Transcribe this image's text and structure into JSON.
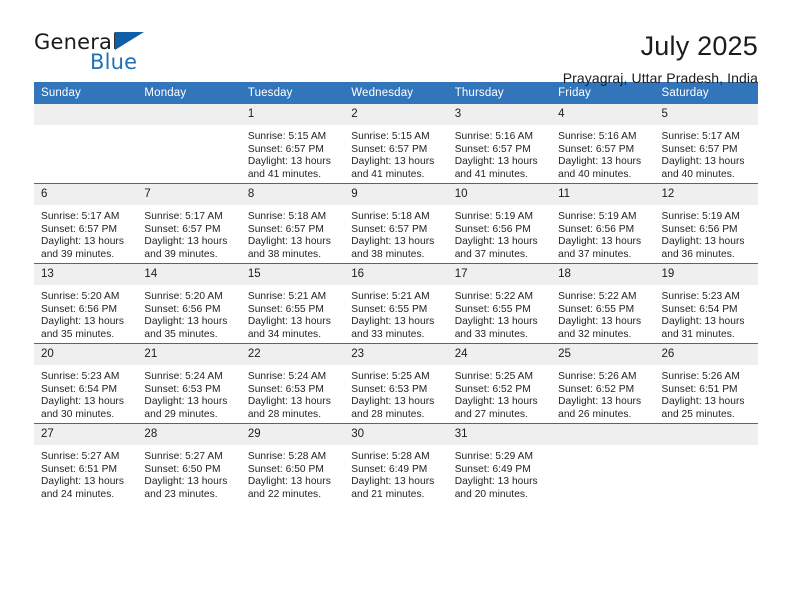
{
  "brand": {
    "name_top": "General",
    "name_bottom": "Blue",
    "triangle_color": "#0f5fa8",
    "blue_text_color": "#2072b8"
  },
  "header": {
    "title": "July 2025",
    "subtitle": "Prayagraj, Uttar Pradesh, India"
  },
  "theme": {
    "header_row_bg": "#3275bb",
    "daynum_bg": "#efefef",
    "row_border": "#2f6daf",
    "page_bg": "#ffffff"
  },
  "weekdays": [
    "Sunday",
    "Monday",
    "Tuesday",
    "Wednesday",
    "Thursday",
    "Friday",
    "Saturday"
  ],
  "weeks": [
    [
      {
        "day": "",
        "sunrise": "",
        "sunset": "",
        "daylight_1": "",
        "daylight_2": ""
      },
      {
        "day": "",
        "sunrise": "",
        "sunset": "",
        "daylight_1": "",
        "daylight_2": ""
      },
      {
        "day": "1",
        "sunrise": "Sunrise: 5:15 AM",
        "sunset": "Sunset: 6:57 PM",
        "daylight_1": "Daylight: 13 hours",
        "daylight_2": "and 41 minutes."
      },
      {
        "day": "2",
        "sunrise": "Sunrise: 5:15 AM",
        "sunset": "Sunset: 6:57 PM",
        "daylight_1": "Daylight: 13 hours",
        "daylight_2": "and 41 minutes."
      },
      {
        "day": "3",
        "sunrise": "Sunrise: 5:16 AM",
        "sunset": "Sunset: 6:57 PM",
        "daylight_1": "Daylight: 13 hours",
        "daylight_2": "and 41 minutes."
      },
      {
        "day": "4",
        "sunrise": "Sunrise: 5:16 AM",
        "sunset": "Sunset: 6:57 PM",
        "daylight_1": "Daylight: 13 hours",
        "daylight_2": "and 40 minutes."
      },
      {
        "day": "5",
        "sunrise": "Sunrise: 5:17 AM",
        "sunset": "Sunset: 6:57 PM",
        "daylight_1": "Daylight: 13 hours",
        "daylight_2": "and 40 minutes."
      }
    ],
    [
      {
        "day": "6",
        "sunrise": "Sunrise: 5:17 AM",
        "sunset": "Sunset: 6:57 PM",
        "daylight_1": "Daylight: 13 hours",
        "daylight_2": "and 39 minutes."
      },
      {
        "day": "7",
        "sunrise": "Sunrise: 5:17 AM",
        "sunset": "Sunset: 6:57 PM",
        "daylight_1": "Daylight: 13 hours",
        "daylight_2": "and 39 minutes."
      },
      {
        "day": "8",
        "sunrise": "Sunrise: 5:18 AM",
        "sunset": "Sunset: 6:57 PM",
        "daylight_1": "Daylight: 13 hours",
        "daylight_2": "and 38 minutes."
      },
      {
        "day": "9",
        "sunrise": "Sunrise: 5:18 AM",
        "sunset": "Sunset: 6:57 PM",
        "daylight_1": "Daylight: 13 hours",
        "daylight_2": "and 38 minutes."
      },
      {
        "day": "10",
        "sunrise": "Sunrise: 5:19 AM",
        "sunset": "Sunset: 6:56 PM",
        "daylight_1": "Daylight: 13 hours",
        "daylight_2": "and 37 minutes."
      },
      {
        "day": "11",
        "sunrise": "Sunrise: 5:19 AM",
        "sunset": "Sunset: 6:56 PM",
        "daylight_1": "Daylight: 13 hours",
        "daylight_2": "and 37 minutes."
      },
      {
        "day": "12",
        "sunrise": "Sunrise: 5:19 AM",
        "sunset": "Sunset: 6:56 PM",
        "daylight_1": "Daylight: 13 hours",
        "daylight_2": "and 36 minutes."
      }
    ],
    [
      {
        "day": "13",
        "sunrise": "Sunrise: 5:20 AM",
        "sunset": "Sunset: 6:56 PM",
        "daylight_1": "Daylight: 13 hours",
        "daylight_2": "and 35 minutes."
      },
      {
        "day": "14",
        "sunrise": "Sunrise: 5:20 AM",
        "sunset": "Sunset: 6:56 PM",
        "daylight_1": "Daylight: 13 hours",
        "daylight_2": "and 35 minutes."
      },
      {
        "day": "15",
        "sunrise": "Sunrise: 5:21 AM",
        "sunset": "Sunset: 6:55 PM",
        "daylight_1": "Daylight: 13 hours",
        "daylight_2": "and 34 minutes."
      },
      {
        "day": "16",
        "sunrise": "Sunrise: 5:21 AM",
        "sunset": "Sunset: 6:55 PM",
        "daylight_1": "Daylight: 13 hours",
        "daylight_2": "and 33 minutes."
      },
      {
        "day": "17",
        "sunrise": "Sunrise: 5:22 AM",
        "sunset": "Sunset: 6:55 PM",
        "daylight_1": "Daylight: 13 hours",
        "daylight_2": "and 33 minutes."
      },
      {
        "day": "18",
        "sunrise": "Sunrise: 5:22 AM",
        "sunset": "Sunset: 6:55 PM",
        "daylight_1": "Daylight: 13 hours",
        "daylight_2": "and 32 minutes."
      },
      {
        "day": "19",
        "sunrise": "Sunrise: 5:23 AM",
        "sunset": "Sunset: 6:54 PM",
        "daylight_1": "Daylight: 13 hours",
        "daylight_2": "and 31 minutes."
      }
    ],
    [
      {
        "day": "20",
        "sunrise": "Sunrise: 5:23 AM",
        "sunset": "Sunset: 6:54 PM",
        "daylight_1": "Daylight: 13 hours",
        "daylight_2": "and 30 minutes."
      },
      {
        "day": "21",
        "sunrise": "Sunrise: 5:24 AM",
        "sunset": "Sunset: 6:53 PM",
        "daylight_1": "Daylight: 13 hours",
        "daylight_2": "and 29 minutes."
      },
      {
        "day": "22",
        "sunrise": "Sunrise: 5:24 AM",
        "sunset": "Sunset: 6:53 PM",
        "daylight_1": "Daylight: 13 hours",
        "daylight_2": "and 28 minutes."
      },
      {
        "day": "23",
        "sunrise": "Sunrise: 5:25 AM",
        "sunset": "Sunset: 6:53 PM",
        "daylight_1": "Daylight: 13 hours",
        "daylight_2": "and 28 minutes."
      },
      {
        "day": "24",
        "sunrise": "Sunrise: 5:25 AM",
        "sunset": "Sunset: 6:52 PM",
        "daylight_1": "Daylight: 13 hours",
        "daylight_2": "and 27 minutes."
      },
      {
        "day": "25",
        "sunrise": "Sunrise: 5:26 AM",
        "sunset": "Sunset: 6:52 PM",
        "daylight_1": "Daylight: 13 hours",
        "daylight_2": "and 26 minutes."
      },
      {
        "day": "26",
        "sunrise": "Sunrise: 5:26 AM",
        "sunset": "Sunset: 6:51 PM",
        "daylight_1": "Daylight: 13 hours",
        "daylight_2": "and 25 minutes."
      }
    ],
    [
      {
        "day": "27",
        "sunrise": "Sunrise: 5:27 AM",
        "sunset": "Sunset: 6:51 PM",
        "daylight_1": "Daylight: 13 hours",
        "daylight_2": "and 24 minutes."
      },
      {
        "day": "28",
        "sunrise": "Sunrise: 5:27 AM",
        "sunset": "Sunset: 6:50 PM",
        "daylight_1": "Daylight: 13 hours",
        "daylight_2": "and 23 minutes."
      },
      {
        "day": "29",
        "sunrise": "Sunrise: 5:28 AM",
        "sunset": "Sunset: 6:50 PM",
        "daylight_1": "Daylight: 13 hours",
        "daylight_2": "and 22 minutes."
      },
      {
        "day": "30",
        "sunrise": "Sunrise: 5:28 AM",
        "sunset": "Sunset: 6:49 PM",
        "daylight_1": "Daylight: 13 hours",
        "daylight_2": "and 21 minutes."
      },
      {
        "day": "31",
        "sunrise": "Sunrise: 5:29 AM",
        "sunset": "Sunset: 6:49 PM",
        "daylight_1": "Daylight: 13 hours",
        "daylight_2": "and 20 minutes."
      },
      {
        "day": "",
        "sunrise": "",
        "sunset": "",
        "daylight_1": "",
        "daylight_2": ""
      },
      {
        "day": "",
        "sunrise": "",
        "sunset": "",
        "daylight_1": "",
        "daylight_2": ""
      }
    ]
  ]
}
